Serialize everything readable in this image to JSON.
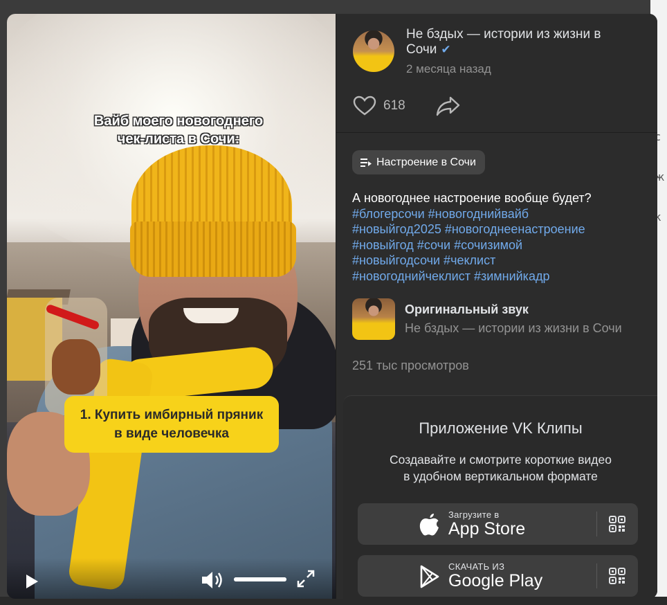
{
  "video": {
    "overlay_title_line1": "Вайб моего новогоднего",
    "overlay_title_line2": "чек-листа в Сочи:",
    "caption_line1": "1. Купить имбирный пряник",
    "caption_line2": "в виде человечка",
    "volume_level": 1.0,
    "play_icon": "play-icon",
    "volume_icon": "volume-icon",
    "fullscreen_icon": "fullscreen-icon"
  },
  "author": {
    "name": "Не бздых — истории из жизни в Сочи",
    "verified": true,
    "time": "2 месяца назад",
    "likes": "618"
  },
  "tag_chip": {
    "label": "Настроение в Сочи"
  },
  "description": {
    "title": "А новогоднее настроение вообще будет?",
    "hashtag_lines": [
      "#блогерсочи #новогоднийвайб",
      "#новыйгод2025 #новогоднеенастроение",
      "#новыйгод #сочи #сочизимой",
      "#новыйгодсочи #чеклист",
      "#новогоднийчеклист #зимнийкадр"
    ]
  },
  "sound": {
    "title": "Оригинальный звук",
    "author": "Не бздых — истории из жизни в Сочи"
  },
  "views": "251 тыс просмотров",
  "promo": {
    "title": "Приложение VK Клипы",
    "text_line1": "Создавайте и смотрите короткие видео",
    "text_line2": "в удобном вертикальном формате",
    "app_store": {
      "small": "Загрузите в",
      "big": "App Store"
    },
    "google_play": {
      "small": "СКАЧАТЬ ИЗ",
      "big": "Google Play"
    }
  },
  "colors": {
    "accent_link": "#71aaeb",
    "panel_bg": "#2c2c2c",
    "caption_yellow": "#f7d21a"
  }
}
